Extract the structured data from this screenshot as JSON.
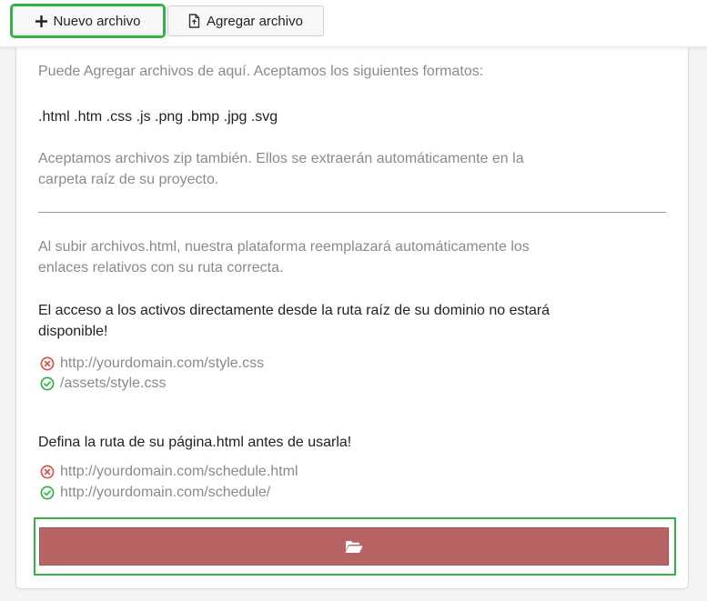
{
  "toolbar": {
    "new_file_label": "Nuevo archivo",
    "upload_file_label": "Agregar archivo"
  },
  "info": {
    "intro": "Puede Agregar archivos de aquí. Aceptamos los siguientes formatos:",
    "formats": ".html .htm .css .js .png .bmp .jpg .svg",
    "zip_note_line1": "Aceptamos archivos zip también. Ellos se extraerán automáticamente en la",
    "zip_note_line2": "carpeta raíz de su proyecto.",
    "html_note_line1": "Al subir archivos.html, nuestra plataforma reemplazará automáticamente los",
    "html_note_line2": "enlaces relativos con su ruta correcta.",
    "root_warning_line1": "El acceso a los activos directamente desde la ruta raíz de su dominio no estará",
    "root_warning_line2": "disponible!",
    "bad_asset_example": "http://yourdomain.com/style.css",
    "good_asset_example": "/assets/style.css",
    "route_warning": "Defina la ruta de su página.html antes de usarla!",
    "bad_route_example": "http://yourdomain.com/schedule.html",
    "good_route_example": "http://yourdomain.com/schedule/"
  },
  "icons": {
    "plus": "plus-icon",
    "file_upload": "file-upload-icon",
    "error": "x-circle-icon",
    "success": "check-circle-icon",
    "folder": "folder-open-icon"
  },
  "colors": {
    "highlight": "#2fb344",
    "upload_button": "#b96464",
    "error": "#d9534f",
    "success": "#2fb344"
  }
}
